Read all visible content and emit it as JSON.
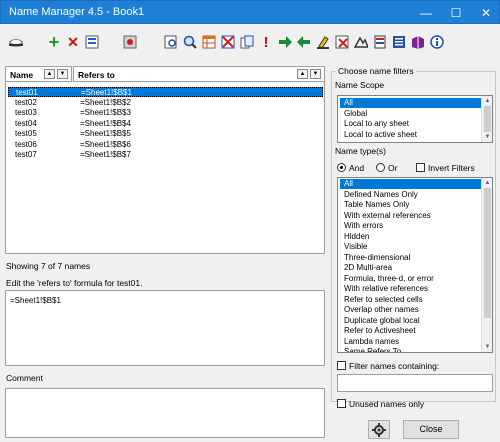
{
  "window": {
    "title": "Name Manager 4.5 - Book1",
    "minimize": "—",
    "maximize": "☐",
    "close": "✕"
  },
  "toolbar": {
    "icons": [
      "eye-glasses-icon",
      "add-name-icon",
      "delete-name-icon",
      "edit-name-icon",
      "bug-icon",
      "find-icon",
      "zoom-icon",
      "table-icon",
      "grid-x-icon",
      "copy-icon",
      "exclamation-icon",
      "arrow-right-icon",
      "arrow-left-icon",
      "highlighter-icon",
      "clear-icon",
      "chart-icon",
      "document-icon",
      "list-icon",
      "book-icon",
      "info-icon"
    ]
  },
  "grid": {
    "col_name": "Name",
    "col_refers": "Refers to",
    "rows": [
      {
        "name": "test01",
        "refers": "=Sheet1!$B$1"
      },
      {
        "name": "test02",
        "refers": "=Sheet1!$B$2"
      },
      {
        "name": "test03",
        "refers": "=Sheet1!$B$3"
      },
      {
        "name": "test04",
        "refers": "=Sheet1!$B$4"
      },
      {
        "name": "test05",
        "refers": "=Sheet1!$B$5"
      },
      {
        "name": "test06",
        "refers": "=Sheet1!$B$6"
      },
      {
        "name": "test07",
        "refers": "=Sheet1!$B$7"
      }
    ],
    "selected_index": 0
  },
  "status": {
    "showing": "Showing 7 of 7 names"
  },
  "edit": {
    "label": "Edit the 'refers to' formula for test01.",
    "value": "=Sheet1!$B$1"
  },
  "comment": {
    "label": "Comment",
    "value": ""
  },
  "filters": {
    "group_title": "Choose name filters",
    "scope_label": "Name Scope",
    "scope_items": [
      "All",
      "Global",
      "Local to any sheet",
      "Local to active sheet"
    ],
    "types_label": "Name type(s)",
    "and_label": "And",
    "or_label": "Or",
    "invert_label": "Invert Filters",
    "type_items": [
      "All",
      "Defined Names Only",
      "Table Names Only",
      "With external references",
      "With errors",
      "Hidden",
      "Visible",
      "Three-dimensional",
      "2D Multi-area",
      "Formula, three-d, or error",
      "With relative references",
      "Refer to selected cells",
      "Overlap other names",
      "Duplicate global local",
      "Refer to Activesheet",
      "Lambda names",
      "Same Refers To"
    ],
    "filter_containing_label": "Filter names containing:",
    "filter_containing_value": "",
    "unused_label": "Unused names only"
  },
  "buttons": {
    "settings_icon": "gear-icon",
    "close_label": "Close"
  }
}
